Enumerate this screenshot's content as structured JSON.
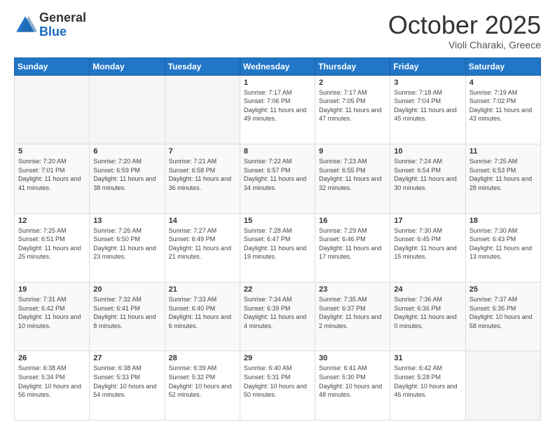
{
  "logo": {
    "general": "General",
    "blue": "Blue"
  },
  "header": {
    "month": "October 2025",
    "location": "Violi Charaki, Greece"
  },
  "weekdays": [
    "Sunday",
    "Monday",
    "Tuesday",
    "Wednesday",
    "Thursday",
    "Friday",
    "Saturday"
  ],
  "weeks": [
    [
      {
        "day": "",
        "info": ""
      },
      {
        "day": "",
        "info": ""
      },
      {
        "day": "",
        "info": ""
      },
      {
        "day": "1",
        "info": "Sunrise: 7:17 AM\nSunset: 7:06 PM\nDaylight: 11 hours and 49 minutes."
      },
      {
        "day": "2",
        "info": "Sunrise: 7:17 AM\nSunset: 7:05 PM\nDaylight: 11 hours and 47 minutes."
      },
      {
        "day": "3",
        "info": "Sunrise: 7:18 AM\nSunset: 7:04 PM\nDaylight: 11 hours and 45 minutes."
      },
      {
        "day": "4",
        "info": "Sunrise: 7:19 AM\nSunset: 7:02 PM\nDaylight: 11 hours and 43 minutes."
      }
    ],
    [
      {
        "day": "5",
        "info": "Sunrise: 7:20 AM\nSunset: 7:01 PM\nDaylight: 11 hours and 41 minutes."
      },
      {
        "day": "6",
        "info": "Sunrise: 7:20 AM\nSunset: 6:59 PM\nDaylight: 11 hours and 38 minutes."
      },
      {
        "day": "7",
        "info": "Sunrise: 7:21 AM\nSunset: 6:58 PM\nDaylight: 11 hours and 36 minutes."
      },
      {
        "day": "8",
        "info": "Sunrise: 7:22 AM\nSunset: 6:57 PM\nDaylight: 11 hours and 34 minutes."
      },
      {
        "day": "9",
        "info": "Sunrise: 7:23 AM\nSunset: 6:55 PM\nDaylight: 11 hours and 32 minutes."
      },
      {
        "day": "10",
        "info": "Sunrise: 7:24 AM\nSunset: 6:54 PM\nDaylight: 11 hours and 30 minutes."
      },
      {
        "day": "11",
        "info": "Sunrise: 7:25 AM\nSunset: 6:53 PM\nDaylight: 11 hours and 28 minutes."
      }
    ],
    [
      {
        "day": "12",
        "info": "Sunrise: 7:25 AM\nSunset: 6:51 PM\nDaylight: 11 hours and 25 minutes."
      },
      {
        "day": "13",
        "info": "Sunrise: 7:26 AM\nSunset: 6:50 PM\nDaylight: 11 hours and 23 minutes."
      },
      {
        "day": "14",
        "info": "Sunrise: 7:27 AM\nSunset: 6:49 PM\nDaylight: 11 hours and 21 minutes."
      },
      {
        "day": "15",
        "info": "Sunrise: 7:28 AM\nSunset: 6:47 PM\nDaylight: 11 hours and 19 minutes."
      },
      {
        "day": "16",
        "info": "Sunrise: 7:29 AM\nSunset: 6:46 PM\nDaylight: 11 hours and 17 minutes."
      },
      {
        "day": "17",
        "info": "Sunrise: 7:30 AM\nSunset: 6:45 PM\nDaylight: 11 hours and 15 minutes."
      },
      {
        "day": "18",
        "info": "Sunrise: 7:30 AM\nSunset: 6:43 PM\nDaylight: 11 hours and 13 minutes."
      }
    ],
    [
      {
        "day": "19",
        "info": "Sunrise: 7:31 AM\nSunset: 6:42 PM\nDaylight: 11 hours and 10 minutes."
      },
      {
        "day": "20",
        "info": "Sunrise: 7:32 AM\nSunset: 6:41 PM\nDaylight: 11 hours and 8 minutes."
      },
      {
        "day": "21",
        "info": "Sunrise: 7:33 AM\nSunset: 6:40 PM\nDaylight: 11 hours and 6 minutes."
      },
      {
        "day": "22",
        "info": "Sunrise: 7:34 AM\nSunset: 6:39 PM\nDaylight: 11 hours and 4 minutes."
      },
      {
        "day": "23",
        "info": "Sunrise: 7:35 AM\nSunset: 6:37 PM\nDaylight: 11 hours and 2 minutes."
      },
      {
        "day": "24",
        "info": "Sunrise: 7:36 AM\nSunset: 6:36 PM\nDaylight: 11 hours and 0 minutes."
      },
      {
        "day": "25",
        "info": "Sunrise: 7:37 AM\nSunset: 6:35 PM\nDaylight: 10 hours and 58 minutes."
      }
    ],
    [
      {
        "day": "26",
        "info": "Sunrise: 6:38 AM\nSunset: 5:34 PM\nDaylight: 10 hours and 56 minutes."
      },
      {
        "day": "27",
        "info": "Sunrise: 6:38 AM\nSunset: 5:33 PM\nDaylight: 10 hours and 54 minutes."
      },
      {
        "day": "28",
        "info": "Sunrise: 6:39 AM\nSunset: 5:32 PM\nDaylight: 10 hours and 52 minutes."
      },
      {
        "day": "29",
        "info": "Sunrise: 6:40 AM\nSunset: 5:31 PM\nDaylight: 10 hours and 50 minutes."
      },
      {
        "day": "30",
        "info": "Sunrise: 6:41 AM\nSunset: 5:30 PM\nDaylight: 10 hours and 48 minutes."
      },
      {
        "day": "31",
        "info": "Sunrise: 6:42 AM\nSunset: 5:28 PM\nDaylight: 10 hours and 46 minutes."
      },
      {
        "day": "",
        "info": ""
      }
    ]
  ]
}
